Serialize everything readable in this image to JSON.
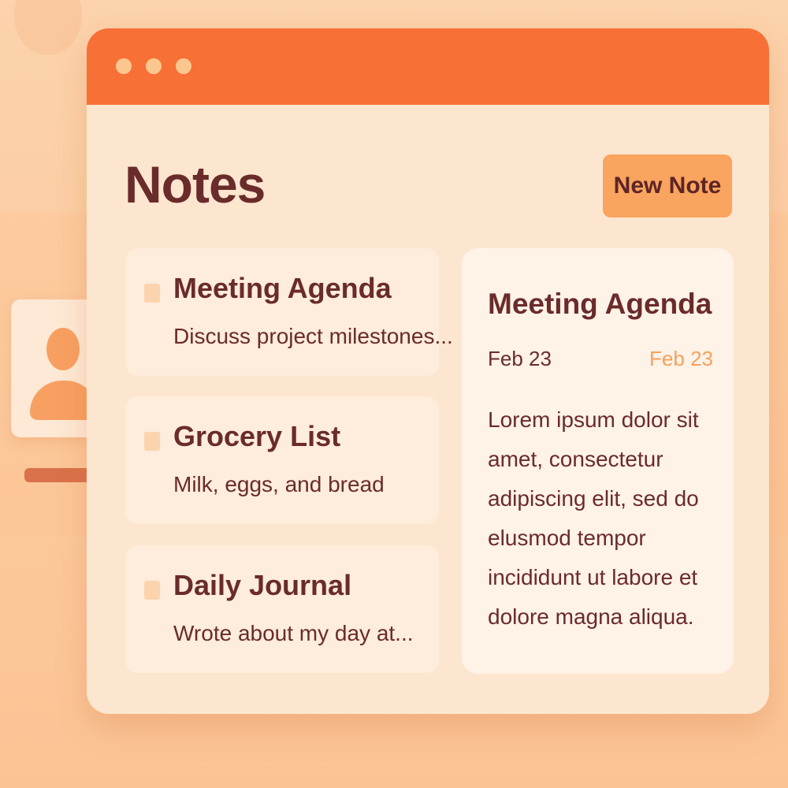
{
  "app": {
    "title": "Notes",
    "new_note_label": "New Note"
  },
  "notes": [
    {
      "title": "Meeting Agenda",
      "preview": "Discuss project milestones..."
    },
    {
      "title": "Grocery List",
      "preview": "Milk, eggs, and bread"
    },
    {
      "title": "Daily Journal",
      "preview": "Wrote about my day at..."
    }
  ],
  "detail": {
    "title": "Meeting Agenda",
    "date": "Feb 23",
    "date_secondary": "Feb 23",
    "body": "Lorem ipsum dolor sit amet, consectetur adipiscing elit, sed do elusmod tempor incididunt ut labore et dolore magna aliqua."
  },
  "colors": {
    "accent": "#f77036",
    "button": "#f9a45f",
    "text": "#6a2b2b",
    "secondary_date": "#f4a15d",
    "background": "#fcd3ac"
  },
  "icons": {
    "window_controls": [
      "window-dot-icon",
      "window-dot-icon",
      "window-dot-icon"
    ],
    "contact": "user-avatar-icon"
  }
}
